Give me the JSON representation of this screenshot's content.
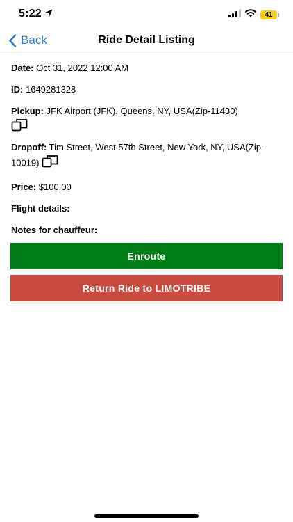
{
  "status": {
    "time": "5:22",
    "battery": "41"
  },
  "nav": {
    "back_label": "Back",
    "title": "Ride Detail Listing"
  },
  "ride": {
    "date_label": "Date:",
    "date_value": "Oct 31, 2022 12:00 AM",
    "id_label": "ID:",
    "id_value": "1649281328",
    "pickup_label": "Pickup:",
    "pickup_value": "JFK Airport (JFK), Queens, NY, USA(Zip-11430)",
    "dropoff_label": "Dropoff:",
    "dropoff_value": "Tim Street, West 57th Street, New York, NY, USA(Zip-10019)",
    "price_label": "Price:",
    "price_value": "$100.00",
    "flight_label": "Flight details:",
    "notes_label": "Notes for chauffeur:"
  },
  "actions": {
    "enroute_label": "Enroute",
    "return_label": "Return Ride to LIMOTRIBE"
  },
  "colors": {
    "enroute": "#007d16",
    "return": "#c94a3e",
    "accent": "#2f7ad8"
  },
  "icons": {
    "copy": "copy-icon",
    "back": "chevron-left-icon",
    "location": "location-arrow-icon"
  }
}
